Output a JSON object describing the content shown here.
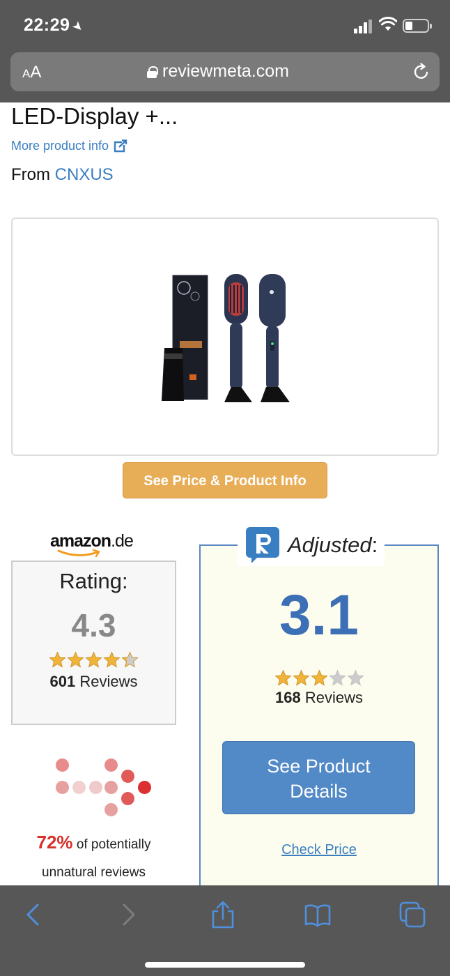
{
  "status_bar": {
    "time": "22:29"
  },
  "url_bar": {
    "aa_label_small": "A",
    "aa_label_large": "A",
    "url": "reviewmeta.com"
  },
  "product": {
    "title": "LED-Display +...",
    "more_info": "More product info",
    "from_label": "From",
    "brand": "CNXUS",
    "price_button": "See Price & Product Info"
  },
  "amazon": {
    "logo_main": "amazon",
    "logo_tld": ".de",
    "rating_label": "Rating:",
    "rating_value": "4.3",
    "stars": 4.3,
    "reviews_count": "601",
    "reviews_label": "Reviews"
  },
  "unnatural": {
    "percent": "72%",
    "text_line1": "of potentially",
    "text_line2": "unnatural reviews"
  },
  "adjusted": {
    "label": "Adjusted",
    "colon": ":",
    "value": "3.1",
    "stars": 3,
    "reviews_count": "168",
    "reviews_label": "Reviews",
    "details_button_line1": "See Product",
    "details_button_line2": "Details",
    "check_price": "Check Price"
  },
  "colors": {
    "chrome": "#575757",
    "link": "#3a7ec2",
    "price_button": "#e8ad57",
    "adjusted_blue": "#3c6fb5",
    "details_button": "#5289c7",
    "warning_red": "#d9302a",
    "star_gold": "#f0b43a",
    "star_gray": "#cccccc"
  },
  "icons": {
    "location": "location-arrow-icon",
    "signal": "cellular-signal-icon",
    "wifi": "wifi-icon",
    "battery": "battery-icon",
    "lock": "lock-icon",
    "reload": "reload-icon",
    "external": "external-link-icon",
    "back": "back-arrow-icon",
    "forward": "forward-arrow-icon",
    "share": "share-icon",
    "bookmarks": "bookmarks-icon",
    "tabs": "tabs-icon"
  }
}
